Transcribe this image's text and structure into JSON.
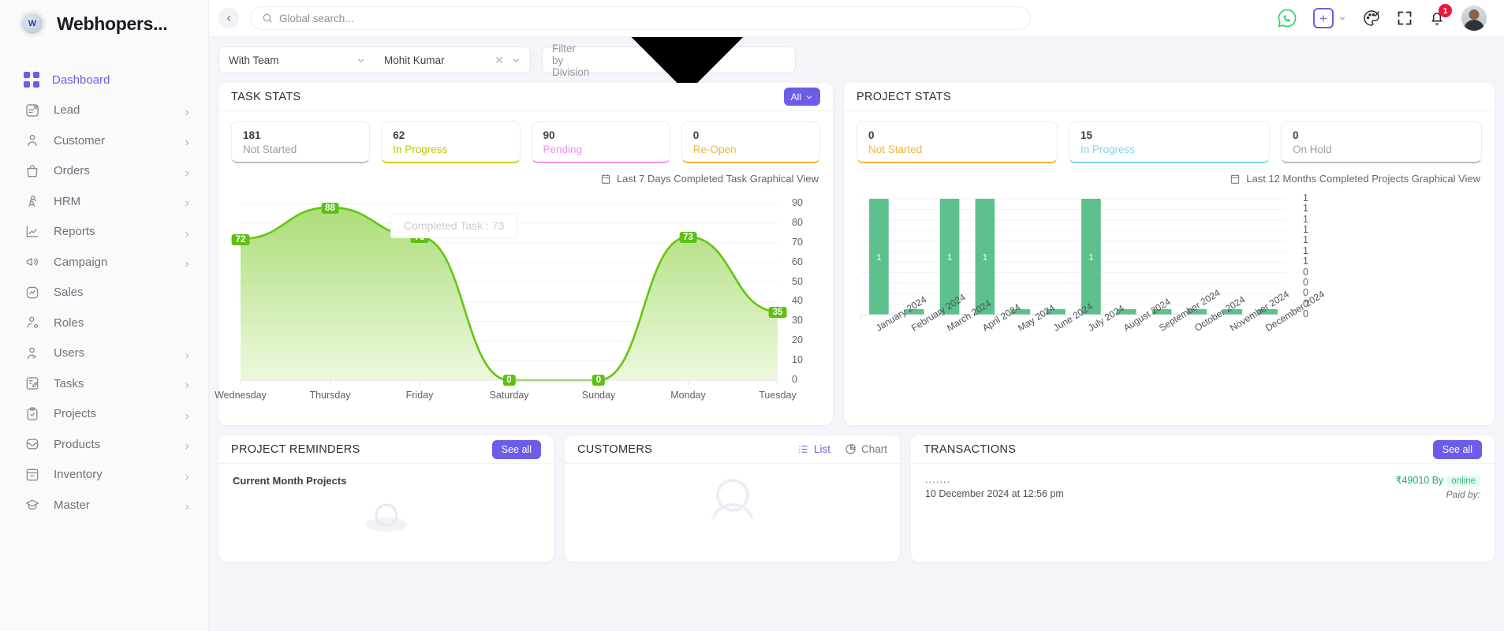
{
  "brand": {
    "title": "Webhopers...",
    "logo_alt": "webhopers-logo"
  },
  "sidebar": {
    "items": [
      {
        "label": "Dashboard",
        "icon": "grid-icon",
        "active": true,
        "chevron": false
      },
      {
        "label": "Lead",
        "icon": "lead-icon",
        "active": false,
        "chevron": true
      },
      {
        "label": "Customer",
        "icon": "user-icon",
        "active": false,
        "chevron": true
      },
      {
        "label": "Orders",
        "icon": "bag-icon",
        "active": false,
        "chevron": true
      },
      {
        "label": "HRM",
        "icon": "people-icon",
        "active": false,
        "chevron": true
      },
      {
        "label": "Reports",
        "icon": "chart-line-icon",
        "active": false,
        "chevron": true
      },
      {
        "label": "Campaign",
        "icon": "megaphone-icon",
        "active": false,
        "chevron": true
      },
      {
        "label": "Sales",
        "icon": "trend-box-icon",
        "active": false,
        "chevron": false
      },
      {
        "label": "Roles",
        "icon": "user-gear-icon",
        "active": false,
        "chevron": false
      },
      {
        "label": "Users",
        "icon": "user-check-icon",
        "active": false,
        "chevron": true
      },
      {
        "label": "Tasks",
        "icon": "task-edit-icon",
        "active": false,
        "chevron": true
      },
      {
        "label": "Projects",
        "icon": "clipboard-check-icon",
        "active": false,
        "chevron": true
      },
      {
        "label": "Products",
        "icon": "inbox-icon",
        "active": false,
        "chevron": true
      },
      {
        "label": "Inventory",
        "icon": "archive-icon",
        "active": false,
        "chevron": true
      },
      {
        "label": "Master",
        "icon": "graduation-cap-icon",
        "active": false,
        "chevron": true
      }
    ]
  },
  "topbar": {
    "collapse_icon": "chevron-left-icon",
    "search_placeholder": "Global search...",
    "search_value": "",
    "actions": [
      {
        "name": "whatsapp-icon"
      },
      {
        "name": "add-new-button",
        "label": "+"
      },
      {
        "name": "theme-palette-icon"
      },
      {
        "name": "fullscreen-icon"
      },
      {
        "name": "notifications-bell-icon",
        "badge": "1"
      },
      {
        "name": "user-avatar"
      }
    ]
  },
  "filters": {
    "scope_value": "With Team",
    "person_value": "Mohit Kumar",
    "division_placeholder": "Filter by Division"
  },
  "task_stats": {
    "title": "TASK STATS",
    "filter_chip": "All",
    "boxes": [
      {
        "value": "181",
        "label": "Not Started",
        "color": "#9b9ea6",
        "accent": "#b9bcc4"
      },
      {
        "value": "62",
        "label": "In Progress",
        "color": "#c3c405",
        "accent": "#cfd004"
      },
      {
        "value": "90",
        "label": "Pending",
        "color": "#ef8ff0",
        "accent": "#ef8ff0"
      },
      {
        "value": "0",
        "label": "Re-Open",
        "color": "#f5b335",
        "accent": "#f5b335"
      }
    ],
    "graph_note": "Last 7 Days Completed Task Graphical View",
    "tooltip": "Completed Task : 73"
  },
  "project_stats": {
    "title": "PROJECT STATS",
    "boxes": [
      {
        "value": "0",
        "label": "Not Started",
        "color": "#f5b335",
        "accent": "#f5b335"
      },
      {
        "value": "15",
        "label": "In Progress",
        "color": "#7fd4e8",
        "accent": "#7fd4e8"
      },
      {
        "value": "0",
        "label": "On Hold",
        "color": "#9b9ea6",
        "accent": "#b9bcc4"
      }
    ],
    "graph_note": "Last 12 Months Completed Projects Graphical View"
  },
  "chart_data": [
    {
      "type": "area",
      "title": "Last 7 Days Completed Task Graphical View",
      "categories": [
        "Wednesday",
        "Thursday",
        "Friday",
        "Saturday",
        "Sunday",
        "Monday",
        "Tuesday"
      ],
      "values": [
        72,
        88,
        73,
        0,
        0,
        73,
        35
      ],
      "xlabel": "",
      "ylabel": "",
      "ylim": [
        0,
        90
      ],
      "yticks": [
        0,
        10,
        20,
        30,
        40,
        50,
        60,
        70,
        80,
        90
      ],
      "grid": true,
      "legend": "none",
      "series_color": "#63c611",
      "data_labels": [
        "72",
        "88",
        "73",
        "0",
        "0",
        "73",
        "35"
      ]
    },
    {
      "type": "bar",
      "title": "Last 12 Months Completed Projects Graphical View",
      "categories": [
        "January 2024",
        "February 2024",
        "March 2024",
        "April 2024",
        "May 2024",
        "June 2024",
        "July 2024",
        "August 2024",
        "September 2024",
        "October 2024",
        "November 2024",
        "December 2024"
      ],
      "values": [
        1,
        0,
        1,
        1,
        0,
        0,
        1,
        0,
        0,
        0,
        0,
        0
      ],
      "xlabel": "",
      "ylabel": "",
      "ylim": [
        0,
        1
      ],
      "yticks": [
        "1",
        "1",
        "1",
        "1",
        "1",
        "1",
        "1",
        "0",
        "0",
        "0",
        "0",
        "0"
      ],
      "grid": true,
      "legend": "none",
      "series_color": "#5ec08c",
      "bar_labels": [
        "1",
        "",
        "1",
        "1",
        "",
        "",
        "1",
        "",
        "",
        "",
        "",
        ""
      ]
    }
  ],
  "project_reminders": {
    "title": "PROJECT REMINDERS",
    "see_all": "See all",
    "subtitle": "Current Month Projects"
  },
  "customers": {
    "title": "CUSTOMERS",
    "view_list": "List",
    "view_chart": "Chart"
  },
  "transactions": {
    "title": "TRANSACTIONS",
    "see_all": "See all",
    "rows": [
      {
        "name": ".......",
        "date": "10 December 2024 at 12:56 pm",
        "amount": "₹49010 By",
        "tag": "online",
        "paid_by": "Paid by:"
      }
    ]
  }
}
